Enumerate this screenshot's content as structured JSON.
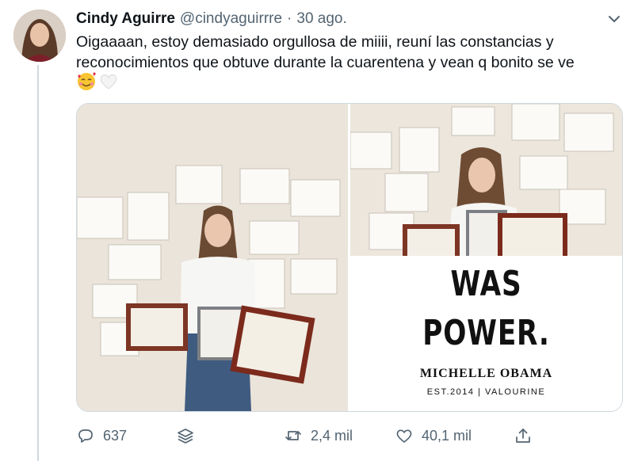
{
  "tweet": {
    "author_name": "Cindy Aguirre",
    "handle": "@cindyaguirrre",
    "separator": "·",
    "date": "30 ago.",
    "text": "Oigaaaan, estoy demasiado orgullosa de miiii, reuní las constancias y reconocimientos que obtuve durante la cuarentena y vean q bonito se ve",
    "emojis": [
      "smiling-face-with-hearts",
      "white-heart"
    ]
  },
  "media": {
    "quote_line_1": "WAS",
    "quote_line_2": "POWER.",
    "quote_author": "MICHELLE OBAMA",
    "quote_tag": "EST.2014 | VALOURINE"
  },
  "actions": {
    "replies": "637",
    "retweets": "2,4 mil",
    "likes": "40,1 mil"
  }
}
